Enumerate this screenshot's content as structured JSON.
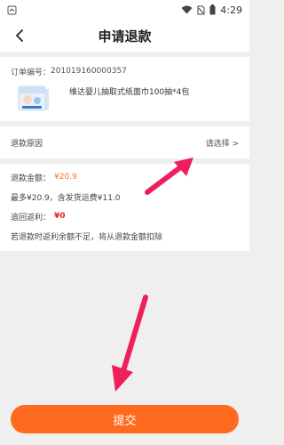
{
  "status_bar": {
    "time": "4:29"
  },
  "nav": {
    "title": "申请退款"
  },
  "order": {
    "number_label": "订单编号：",
    "number": "201019160000357",
    "product_name": "维达婴儿抽取式纸面巾100抽*4包"
  },
  "reason": {
    "label": "退款原因",
    "select_text": "请选择 >"
  },
  "refund": {
    "amount_label": "退款金额：",
    "amount_value": "¥20.9",
    "max_text": "最多¥20.9，含发货运费¥11.0",
    "rebate_label": "追回返利：",
    "rebate_value": "¥0",
    "note": "若退款时返利余额不足，将从退款金额扣除"
  },
  "submit": {
    "label": "提交"
  },
  "colors": {
    "accent": "#ff6a1e",
    "arrow": "#ee1f5a",
    "rebate": "#e82020"
  }
}
